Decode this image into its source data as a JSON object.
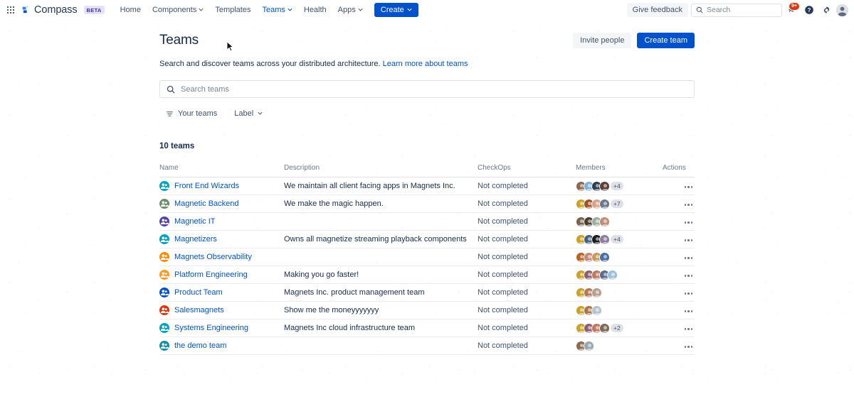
{
  "topnav": {
    "app_switcher_icon": "app-switcher-grid-icon",
    "brand_name": "Compass",
    "brand_badge": "BETA",
    "items": [
      {
        "label": "Home",
        "has_chevron": false,
        "active": false
      },
      {
        "label": "Components",
        "has_chevron": true,
        "active": false
      },
      {
        "label": "Templates",
        "has_chevron": false,
        "active": false
      },
      {
        "label": "Teams",
        "has_chevron": true,
        "active": true
      },
      {
        "label": "Health",
        "has_chevron": false,
        "active": false
      },
      {
        "label": "Apps",
        "has_chevron": true,
        "active": false
      }
    ],
    "create_label": "Create",
    "feedback_label": "Give feedback",
    "search_placeholder": "Search",
    "notification_badge": "9+",
    "icons": [
      "notification-megaphone-icon",
      "help-icon",
      "settings-gear-icon",
      "profile-avatar"
    ]
  },
  "page": {
    "title": "Teams",
    "invite_label": "Invite people",
    "create_team_label": "Create team",
    "subtitle_text": "Search and discover teams across your distributed architecture.",
    "subtitle_link": "Learn more about teams",
    "search_placeholder": "Search teams",
    "filter_your_teams": "Your teams",
    "filter_label": "Label",
    "count_label": "10 teams"
  },
  "table": {
    "columns": [
      "Name",
      "Description",
      "CheckOps",
      "Members",
      "Actions"
    ],
    "rows": [
      {
        "name": "Front End Wizards",
        "description": "We maintain all client facing apps in Magnets Inc.",
        "checkops": "Not completed",
        "avatar_color": "#00a3bf",
        "member_avatars": [
          "#8b6a4f",
          "#7fb3d5",
          "#2c3e50",
          "#5d4037"
        ],
        "member_overflow": "+4"
      },
      {
        "name": "Magnetic Backend",
        "description": "We make the magic happen.",
        "checkops": "Not completed",
        "avatar_color": "#6b8e6b",
        "member_avatars": [
          "#c9a227",
          "#a0522d",
          "#d9a38a",
          "#6b7b8c"
        ],
        "member_overflow": "+7"
      },
      {
        "name": "Magnetic IT",
        "description": "",
        "checkops": "Not completed",
        "avatar_color": "#5243aa",
        "member_avatars": [
          "#7a6250",
          "#4a3c2f",
          "#9fae9f",
          "#c08f7a"
        ],
        "member_overflow": ""
      },
      {
        "name": "Magnetizers",
        "description": "Owns all magnetize streaming playback components",
        "checkops": "Not completed",
        "avatar_color": "#00a3bf",
        "member_avatars": [
          "#c9a227",
          "#46627f",
          "#1c1c1c",
          "#8e7f9e"
        ],
        "member_overflow": "+4"
      },
      {
        "name": "Magnets Observability",
        "description": "",
        "checkops": "Not completed",
        "avatar_color": "#ff8b00",
        "member_avatars": [
          "#b5651d",
          "#c58a7a",
          "#c79a5b",
          "#4a6fa5"
        ],
        "member_overflow": ""
      },
      {
        "name": "Platform Engineering",
        "description": "Making you go faster!",
        "checkops": "Not completed",
        "avatar_color": "#ff991f",
        "member_avatars": [
          "#c9a227",
          "#8e5f6e",
          "#c0795e",
          "#5a6e8c",
          "#9fc0d9"
        ],
        "member_overflow": ""
      },
      {
        "name": "Product Team",
        "description": "Magnets Inc. product management team",
        "checkops": "Not completed",
        "avatar_color": "#0052cc",
        "member_avatars": [
          "#c9a227",
          "#b07a5a",
          "#b9a08f"
        ],
        "member_overflow": ""
      },
      {
        "name": "Salesmagnets",
        "description": "Show me the moneyyyyyyy",
        "checkops": "Not completed",
        "avatar_color": "#de350b",
        "member_avatars": [
          "#c9a227",
          "#a9764f",
          "#b6c4cf"
        ],
        "member_overflow": ""
      },
      {
        "name": "Systems Engineering",
        "description": "Magnets Inc cloud infrastructure team",
        "checkops": "Not completed",
        "avatar_color": "#00a3bf",
        "member_avatars": [
          "#c9a227",
          "#8e5f6e",
          "#c0795e",
          "#7d6a58"
        ],
        "member_overflow": "+2"
      },
      {
        "name": "the demo team",
        "description": "",
        "checkops": "Not completed",
        "avatar_color": "#0e8fa8",
        "member_avatars": [
          "#8b6a4f",
          "#9aa7b1"
        ],
        "member_overflow": ""
      }
    ]
  }
}
